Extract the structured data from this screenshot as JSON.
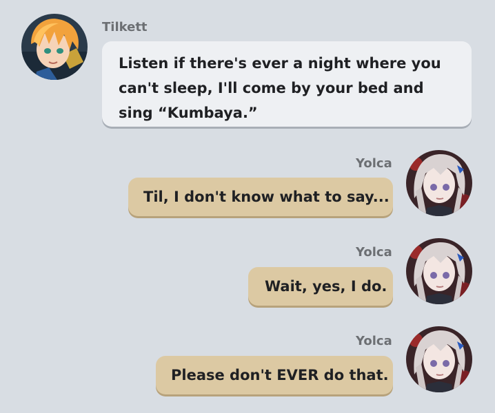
{
  "messages": [
    {
      "sender": "Tilkett",
      "side": "left",
      "avatar": "tilkett-avatar",
      "text": "Listen if there's ever a night where you can't sleep, I'll come by your bed and sing “Kumbaya.”"
    },
    {
      "sender": "Yolca",
      "side": "right",
      "avatar": "yolca-avatar",
      "text": "Til, I don't know what to say..."
    },
    {
      "sender": "Yolca",
      "side": "right",
      "avatar": "yolca-avatar",
      "text": "Wait, yes, I do."
    },
    {
      "sender": "Yolca",
      "side": "right",
      "avatar": "yolca-avatar",
      "text": "Please don't EVER do that."
    }
  ],
  "colors": {
    "background": "#d8dde3",
    "left_bubble": "#eef0f3",
    "right_bubble": "#dcc9a3",
    "name_text": "#6c6f73"
  }
}
